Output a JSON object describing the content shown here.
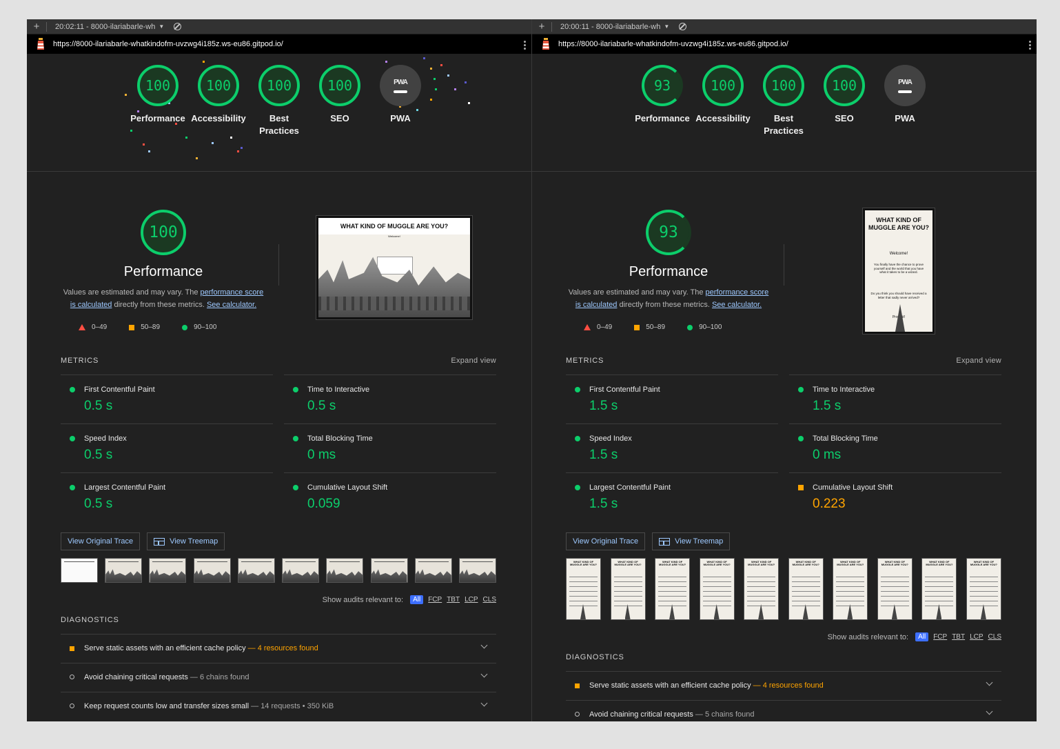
{
  "left": {
    "tab": {
      "title": "20:02:11 - 8000-ilariabarle-wh"
    },
    "url": "https://8000-ilariabarle-whatkindofm-uvzwg4i185z.ws-eu86.gitpod.io/",
    "gauges": [
      {
        "score": "100",
        "label": "Performance"
      },
      {
        "score": "100",
        "label": "Accessibility"
      },
      {
        "score": "100",
        "label": "Best Practices"
      },
      {
        "score": "100",
        "label": "SEO"
      }
    ],
    "pwa_label": "PWA",
    "pwa_badge": "PWA",
    "perf_score": "100",
    "metrics": [
      {
        "name": "First Contentful Paint",
        "value": "0.5 s",
        "status": "pass"
      },
      {
        "name": "Time to Interactive",
        "value": "0.5 s",
        "status": "pass"
      },
      {
        "name": "Speed Index",
        "value": "0.5 s",
        "status": "pass"
      },
      {
        "name": "Total Blocking Time",
        "value": "0 ms",
        "status": "pass"
      },
      {
        "name": "Largest Contentful Paint",
        "value": "0.5 s",
        "status": "pass"
      },
      {
        "name": "Cumulative Layout Shift",
        "value": "0.059",
        "status": "pass"
      }
    ],
    "screenshot": {
      "title": "WHAT KIND OF MUGGLE ARE YOU?",
      "welcome": "Welcome!"
    },
    "audits": [
      {
        "title": "Serve static assets with an efficient cache policy",
        "detail": "4 resources found",
        "type": "warn"
      },
      {
        "title": "Avoid chaining critical requests",
        "detail": "6 chains found",
        "type": "info"
      },
      {
        "title": "Keep request counts low and transfer sizes small",
        "detail": "14 requests • 350 KiB",
        "type": "info"
      }
    ]
  },
  "right": {
    "tab": {
      "title": "20:00:11 - 8000-ilariabarle-wh"
    },
    "url": "https://8000-ilariabarle-whatkindofm-uvzwg4i185z.ws-eu86.gitpod.io/",
    "gauges": [
      {
        "score": "93",
        "label": "Performance"
      },
      {
        "score": "100",
        "label": "Accessibility"
      },
      {
        "score": "100",
        "label": "Best Practices"
      },
      {
        "score": "100",
        "label": "SEO"
      }
    ],
    "pwa_label": "PWA",
    "pwa_badge": "PWA",
    "perf_score": "93",
    "metrics": [
      {
        "name": "First Contentful Paint",
        "value": "1.5 s",
        "status": "pass"
      },
      {
        "name": "Time to Interactive",
        "value": "1.5 s",
        "status": "pass"
      },
      {
        "name": "Speed Index",
        "value": "1.5 s",
        "status": "pass"
      },
      {
        "name": "Total Blocking Time",
        "value": "0 ms",
        "status": "pass"
      },
      {
        "name": "Largest Contentful Paint",
        "value": "1.5 s",
        "status": "pass"
      },
      {
        "name": "Cumulative Layout Shift",
        "value": "0.223",
        "status": "average"
      }
    ],
    "screenshot": {
      "title": "WHAT KIND OF MUGGLE ARE YOU?",
      "welcome": "Welcome!",
      "body1": "You finally have the chance to prove yourself and the world that you have what it takes to be a wizard.",
      "body2": "Do you think you should have received a letter that sadly never arrived?",
      "prove": "Prove it!"
    },
    "audits": [
      {
        "title": "Serve static assets with an efficient cache policy",
        "detail": "4 resources found",
        "type": "warn"
      },
      {
        "title": "Avoid chaining critical requests",
        "detail": "5 chains found",
        "type": "info"
      }
    ]
  },
  "common": {
    "perf_title": "Performance",
    "desc_prefix": "Values are estimated and may vary. The ",
    "desc_link1": "performance score is calculated",
    "desc_mid": " directly from these metrics. ",
    "desc_link2": "See calculator.",
    "legend": [
      "0–49",
      "50–89",
      "90–100"
    ],
    "metrics_title": "METRICS",
    "expand_view": "Expand view",
    "btn_trace": "View Original Trace",
    "btn_treemap": "View Treemap",
    "show_audits": "Show audits relevant to:",
    "filters": [
      "All",
      "FCP",
      "TBT",
      "LCP",
      "CLS"
    ],
    "diagnostics_title": "DIAGNOSTICS",
    "tab_plus": "+",
    "colors": {
      "pass": "#0cce6b",
      "average": "#ffa400",
      "fail": "#ff4e42",
      "link": "#9ec9ff"
    }
  }
}
